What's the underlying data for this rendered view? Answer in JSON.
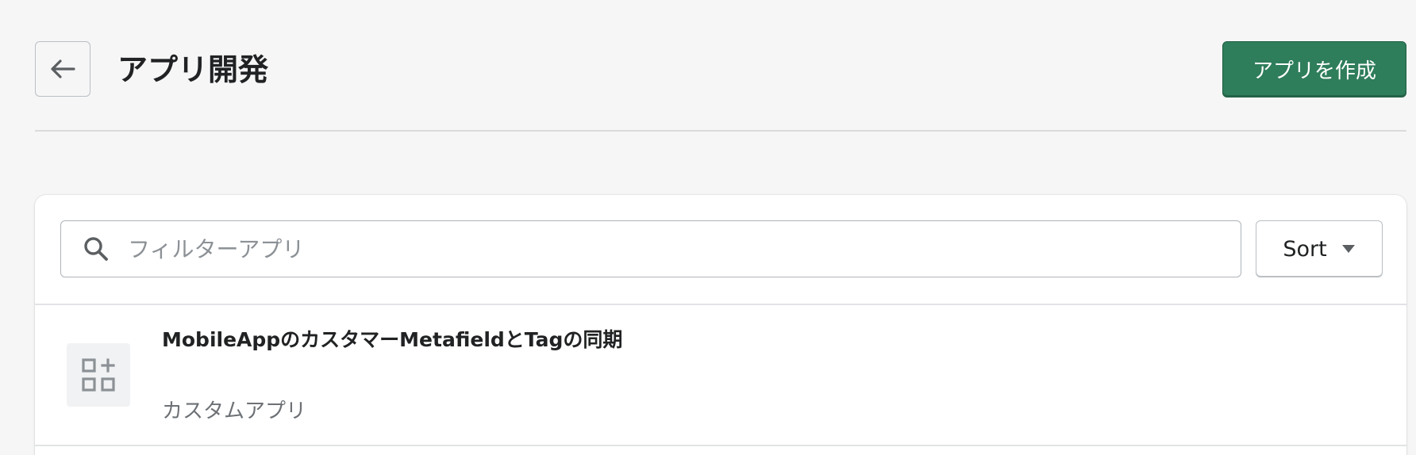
{
  "header": {
    "title": "アプリ開発",
    "back_icon": "arrow-left-icon",
    "create_button_label": "アプリを作成"
  },
  "filters": {
    "search_placeholder": "フィルターアプリ",
    "search_value": "",
    "search_icon": "search-icon",
    "sort_label": "Sort",
    "sort_icon": "caret-down-icon"
  },
  "apps": [
    {
      "name": "MobileAppのカスタマーMetafieldとTagの同期",
      "type": "カスタムアプリ",
      "icon": "apps-add-icon"
    }
  ],
  "colors": {
    "primary": "#2e7d5b",
    "background": "#f6f6f7",
    "card": "#ffffff",
    "subdued_text": "#6d7175"
  }
}
